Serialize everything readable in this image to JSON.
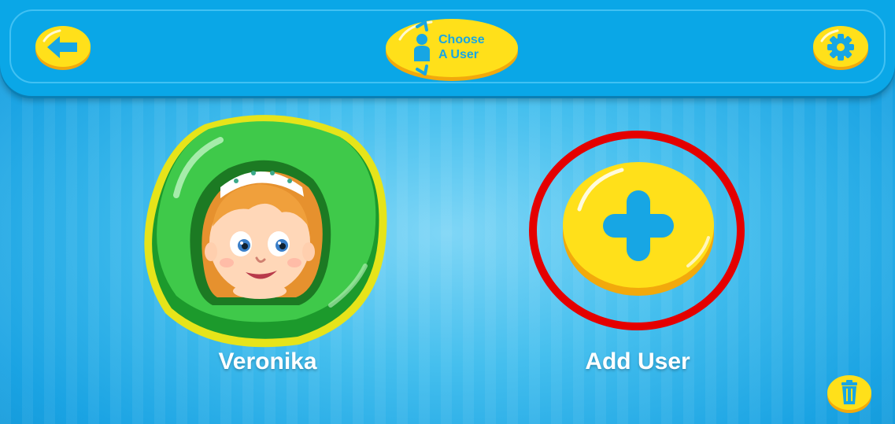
{
  "header": {
    "title_line1": "Choose",
    "title_line2": "A User"
  },
  "users": [
    {
      "name": "Veronika"
    }
  ],
  "add_user": {
    "label": "Add User"
  },
  "icons": {
    "back": "arrow-left-icon",
    "settings": "gear-icon",
    "choose": "person-swap-icon",
    "add": "plus-icon",
    "delete": "trash-icon"
  },
  "colors": {
    "sky_blue": "#1aa3e3",
    "yellow": "#ffe01a",
    "green": "#3fc94a",
    "accent_blue": "#17a6e4",
    "highlight_red": "#e40000"
  }
}
